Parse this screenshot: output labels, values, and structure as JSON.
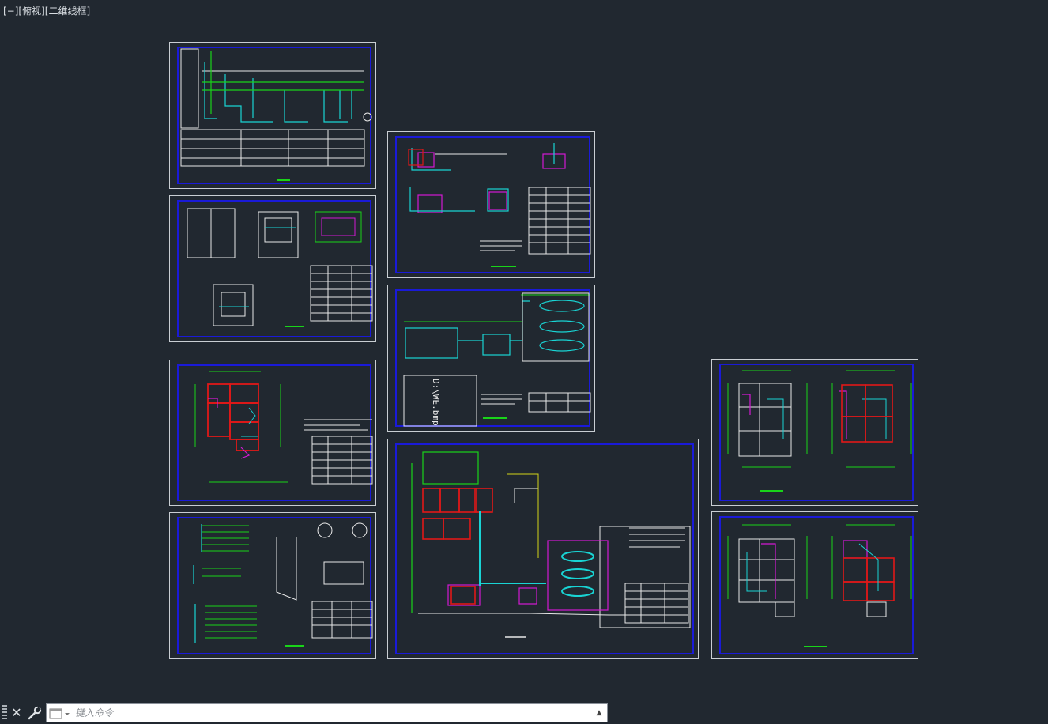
{
  "viewport": {
    "control": "[−]",
    "view": "[俯视]",
    "style": "[二维线框]"
  },
  "canvas_text": {
    "image_placeholder": "D:\\WE.bmp"
  },
  "command_line": {
    "close_icon": "close-icon",
    "customize_icon": "wrench-icon",
    "history_icon": "command-prompt-icon",
    "placeholder": "键入命令",
    "value": "",
    "scroll_up_icon": "triangle-up-icon"
  },
  "colors": {
    "background": "#212830",
    "sheet_border": "#c9ced3",
    "frame": "#1a1ad8",
    "green": "#19d419",
    "cyan": "#19d4d4",
    "magenta": "#d419d4",
    "red": "#e01818",
    "yellow": "#d4d419",
    "white": "#e8e8e8"
  }
}
